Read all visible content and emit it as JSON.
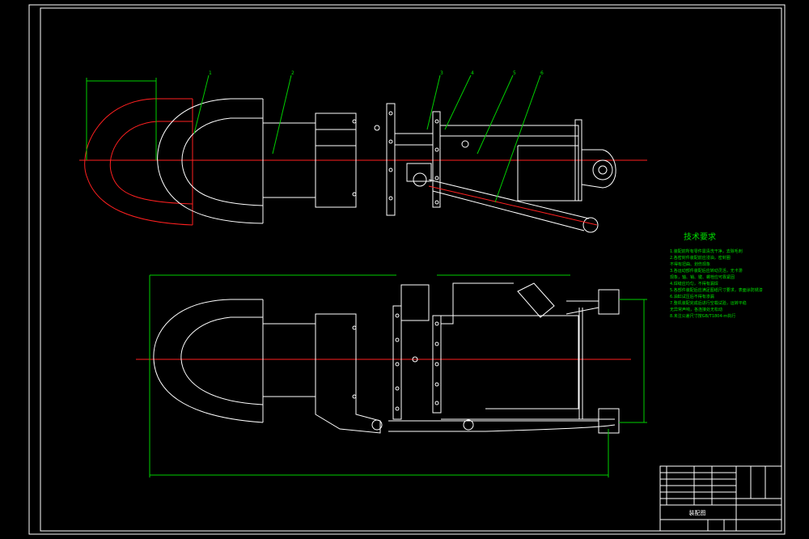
{
  "drawing": {
    "tech_requirements": {
      "title": "技术要求",
      "lines": [
        "1.装配前所有零件需清洗干净，去除毛刺",
        "2.各密封件装配前应浸油，密封圈",
        "  不得有扭曲、划伤现象",
        "3.各运动部件装配后应转动灵活，无卡滞",
        "  现象，轴、销、键、螺栓应可靠紧固",
        "4.焊缝应均匀，不得有漏焊",
        "5.各部件装配后应满足图纸尺寸要求，表面涂防锈漆",
        "6.油缸试压后不得有渗漏",
        "7.整机装配完成后进行空载试验，运转平稳",
        "  无异常声响，各连接处无松动",
        "8.未注公差尺寸按GB/T1804-m执行"
      ]
    },
    "title_block": {
      "drawing_name": "装配图",
      "rows": [
        "",
        "",
        "",
        "",
        ""
      ]
    },
    "part_labels": [
      "1",
      "2",
      "3",
      "4",
      "5",
      "6"
    ],
    "dimensions": {
      "top_width": "",
      "bottom_length": "",
      "bottom_span": "",
      "right_height": ""
    }
  }
}
